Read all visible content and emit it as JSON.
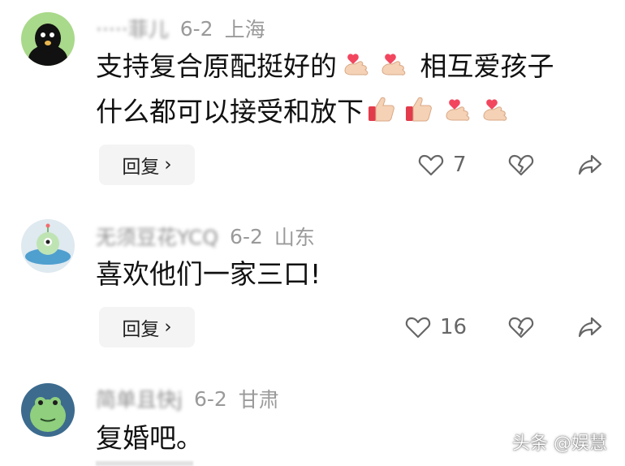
{
  "comments": [
    {
      "username": "‧‧‧‧‧菲儿",
      "date": "6-2",
      "location": "上海",
      "line1": "支持复合原配挺好的",
      "line1b": "相互爱孩子",
      "line2": "什么都可以接受和放下",
      "reply_label": "回复",
      "reply_chevron": "›",
      "like_count": "7",
      "avatar_icon": "black-cartoon-avatar"
    },
    {
      "username": "无须豆花YCQ",
      "date": "6-2",
      "location": "山东",
      "line1": "喜欢他们一家三口!",
      "reply_label": "回复",
      "reply_chevron": "›",
      "like_count": "16",
      "avatar_icon": "alien-ufo-avatar"
    },
    {
      "username": "简单且快j",
      "date": "6-2",
      "location": "甘肃",
      "line1": "复婚吧。",
      "avatar_icon": "green-frog-avatar"
    }
  ],
  "watermark": "头条 @娱慧",
  "icons": {
    "like": "heart-outline-icon",
    "dislike": "broken-heart-icon",
    "share": "share-arrow-icon",
    "heart_hand": "finger-heart-emoji",
    "thumbs_up": "thumbs-up-emoji"
  }
}
